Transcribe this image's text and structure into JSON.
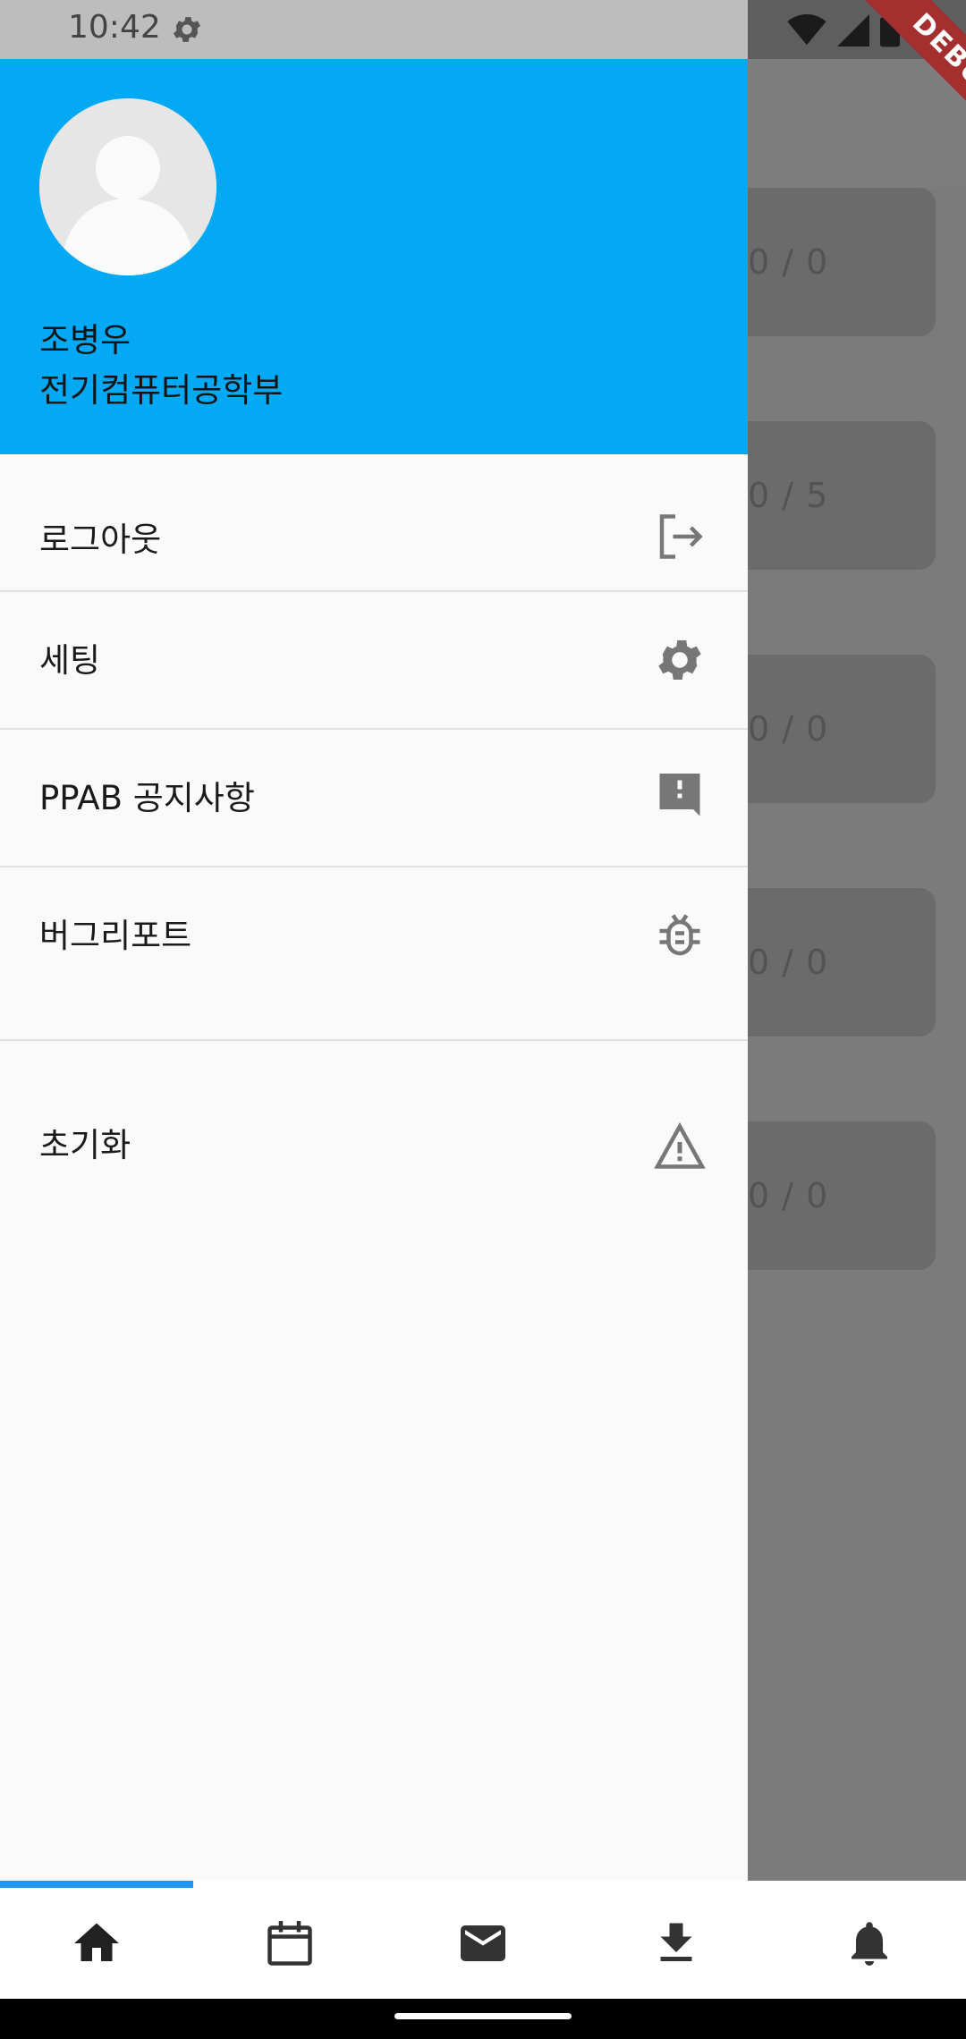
{
  "status_bar": {
    "time": "10:42",
    "icons": [
      "gear-icon",
      "wifi-icon",
      "signal-icon",
      "battery-icon"
    ],
    "debug_banner": "DEBUG"
  },
  "background_cards": [
    {
      "value": "0 / 0"
    },
    {
      "value": "0 / 5"
    },
    {
      "value": "0 / 0"
    },
    {
      "value": "0 / 0"
    },
    {
      "value": "0 / 0"
    }
  ],
  "drawer": {
    "header_color": "#03a9f4",
    "user_name": "조병우",
    "user_department": "전기컴퓨터공학부",
    "items": [
      {
        "label": "로그아웃",
        "icon": "logout-icon"
      },
      {
        "label": "세팅",
        "icon": "gear-icon"
      },
      {
        "label": "PPAB 공지사항",
        "icon": "announcement-icon"
      },
      {
        "label": "버그리포트",
        "icon": "bug-icon"
      },
      {
        "label": "초기화",
        "icon": "warning-icon"
      }
    ]
  },
  "bottom_nav": {
    "accent_color": "#2196f3",
    "items": [
      {
        "name": "home",
        "icon": "home-icon",
        "selected": true
      },
      {
        "name": "calendar",
        "icon": "calendar-icon",
        "selected": false
      },
      {
        "name": "mail",
        "icon": "mail-icon",
        "selected": false
      },
      {
        "name": "download",
        "icon": "download-icon",
        "selected": false
      },
      {
        "name": "notifications",
        "icon": "bell-icon",
        "selected": false
      }
    ]
  }
}
